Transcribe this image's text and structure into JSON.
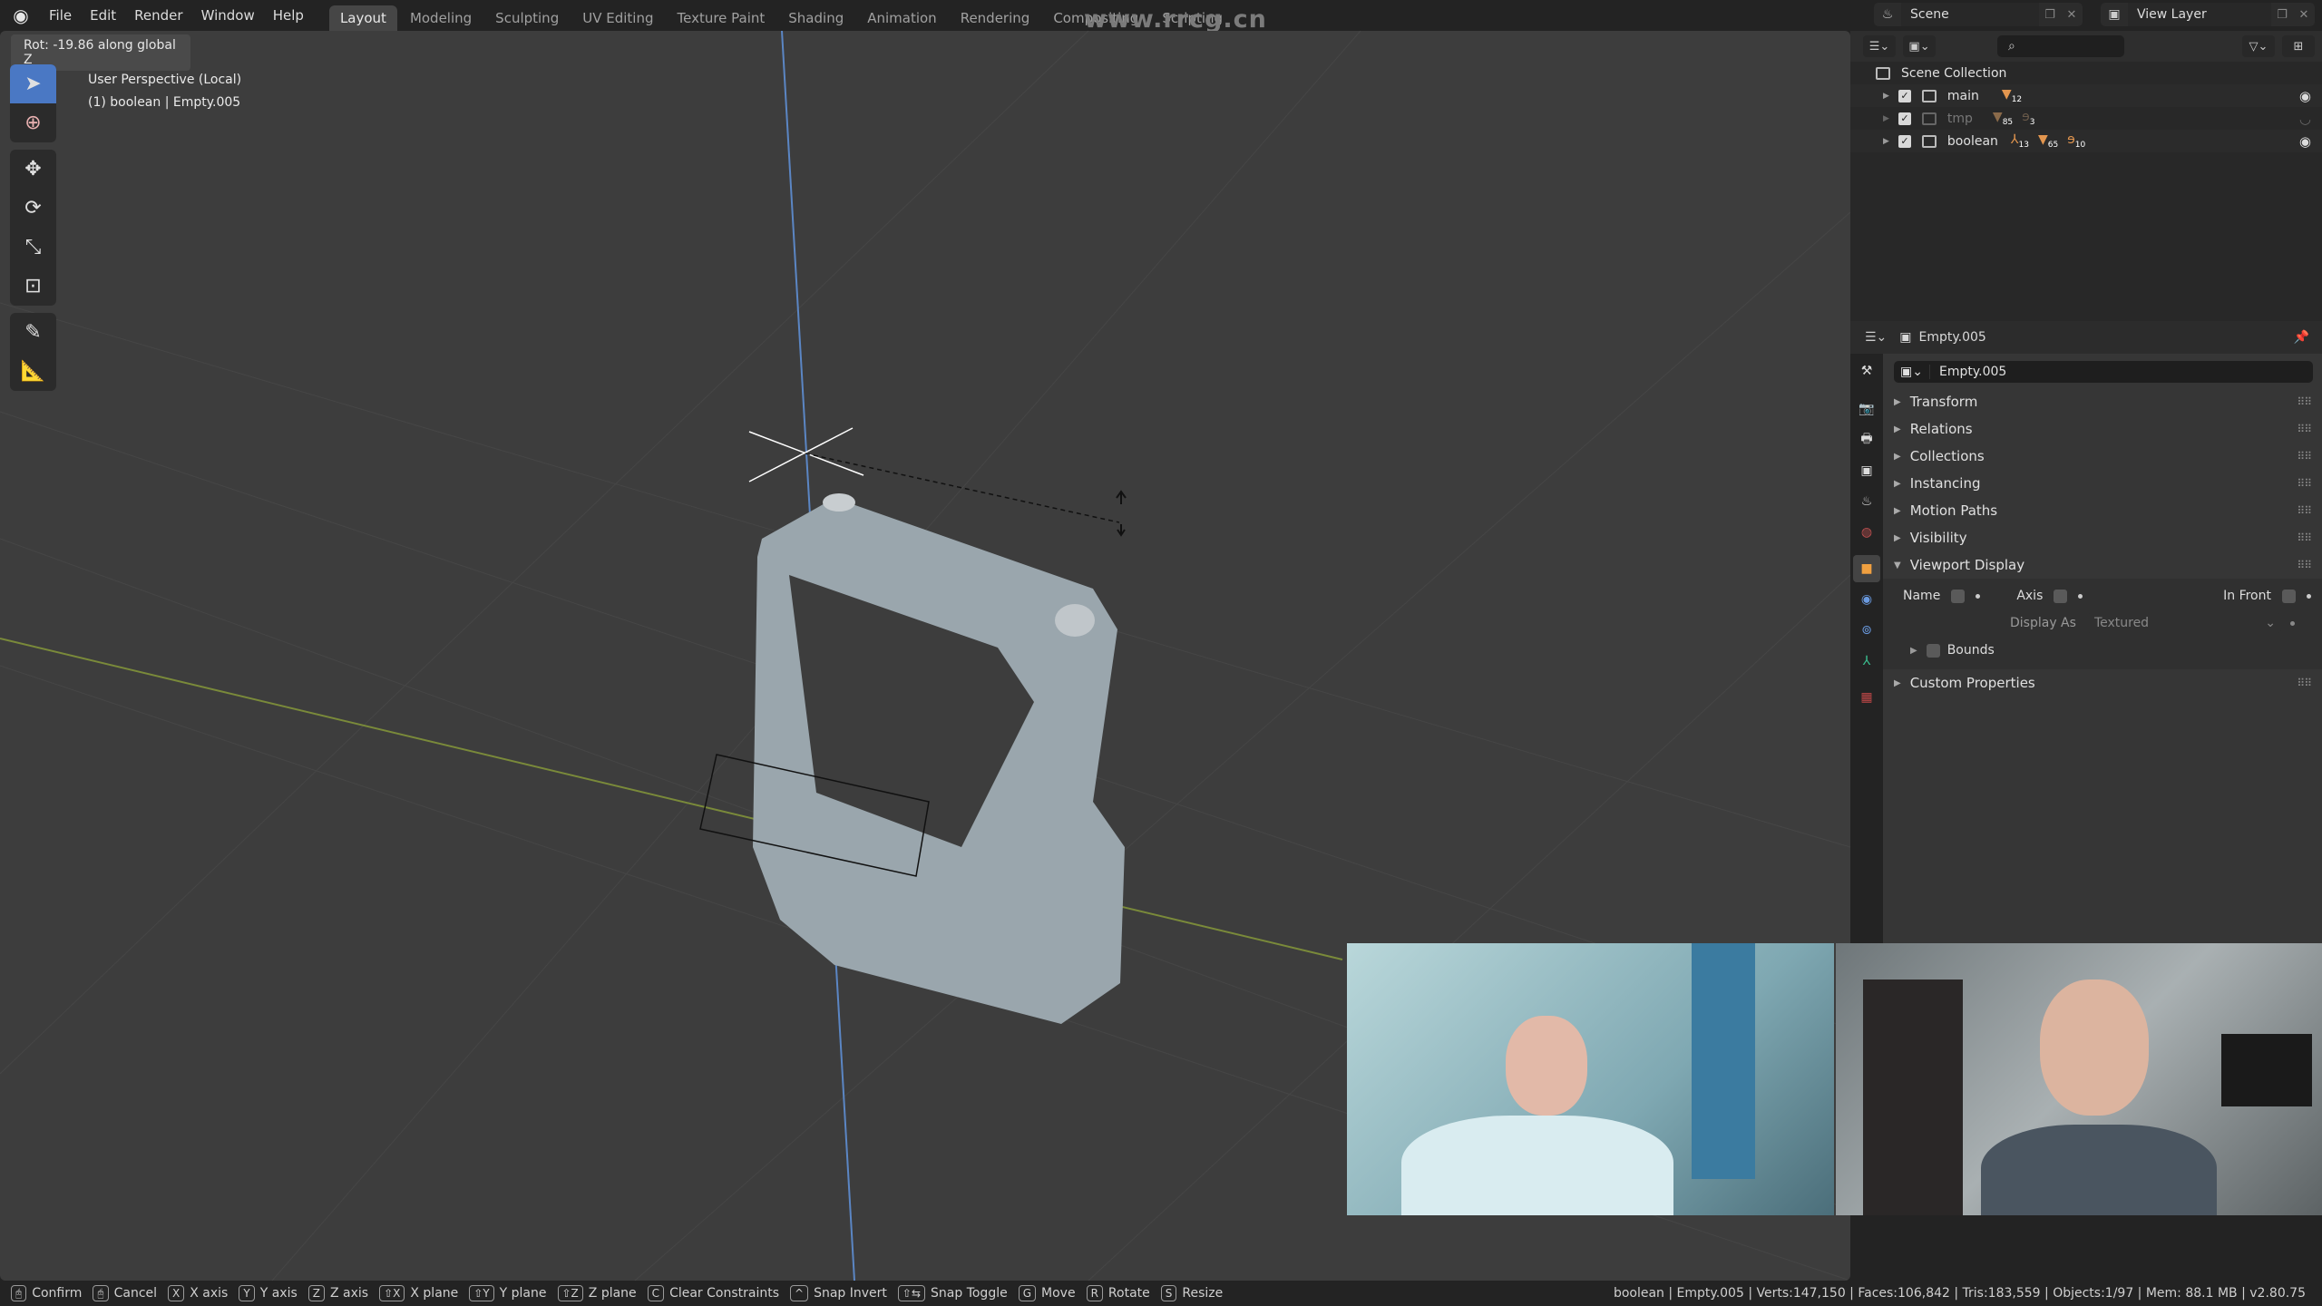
{
  "topbar": {
    "menu": [
      "File",
      "Edit",
      "Render",
      "Window",
      "Help"
    ],
    "workspaces": [
      "Layout",
      "Modeling",
      "Sculpting",
      "UV Editing",
      "Texture Paint",
      "Shading",
      "Animation",
      "Rendering",
      "Compositing",
      "Scripting"
    ],
    "active_workspace": "Layout",
    "watermark": "www.rrcg.cn",
    "scene": "Scene",
    "view_layer": "View Layer"
  },
  "viewport": {
    "operator_info": "Rot: -19.86 along global Z",
    "perspective": "User Perspective (Local)",
    "object_info": "(1) boolean | Empty.005",
    "tools": [
      "select-box",
      "cursor",
      "move",
      "rotate",
      "scale",
      "transform",
      "annotate",
      "measure"
    ]
  },
  "outliner": {
    "search_placeholder": "",
    "root": "Scene Collection",
    "collections": [
      {
        "name": "main",
        "badges": [
          {
            "icon": "mesh",
            "count": "12"
          }
        ],
        "visible": true
      },
      {
        "name": "tmp",
        "badges": [
          {
            "icon": "mesh",
            "count": "85"
          },
          {
            "icon": "curve",
            "count": "3"
          }
        ],
        "visible": false
      },
      {
        "name": "boolean",
        "badges": [
          {
            "icon": "empty",
            "count": "13"
          },
          {
            "icon": "mesh",
            "count": "65"
          },
          {
            "icon": "curve",
            "count": "10"
          }
        ],
        "visible": true
      }
    ]
  },
  "properties": {
    "context_name": "Empty.005",
    "object_name": "Empty.005",
    "panels": [
      "Transform",
      "Relations",
      "Collections",
      "Instancing",
      "Motion Paths",
      "Visibility",
      "Viewport Display",
      "Custom Properties"
    ],
    "viewport_display": {
      "name_label": "Name",
      "axis_label": "Axis",
      "in_front_label": "In Front",
      "display_as_label": "Display As",
      "display_as_value": "Textured",
      "bounds_label": "Bounds"
    }
  },
  "statusbar": {
    "hints": [
      {
        "key": "LMB",
        "label": "Confirm"
      },
      {
        "key": "RMB",
        "label": "Cancel"
      },
      {
        "key": "X",
        "label": "X axis"
      },
      {
        "key": "Y",
        "label": "Y axis"
      },
      {
        "key": "Z",
        "label": "Z axis"
      },
      {
        "key": "⇧X",
        "label": "X plane"
      },
      {
        "key": "⇧Y",
        "label": "Y plane"
      },
      {
        "key": "⇧Z",
        "label": "Z plane"
      },
      {
        "key": "C",
        "label": "Clear Constraints"
      },
      {
        "key": "^",
        "label": "Snap Invert"
      },
      {
        "key": "⇧⇆",
        "label": "Snap Toggle"
      },
      {
        "key": "G",
        "label": "Move"
      },
      {
        "key": "R",
        "label": "Rotate"
      },
      {
        "key": "S",
        "label": "Resize"
      }
    ],
    "stats": "boolean | Empty.005 | Verts:147,150 | Faces:106,842 | Tris:183,559 | Objects:1/97 | Mem: 88.1 MB | v2.80.75"
  }
}
